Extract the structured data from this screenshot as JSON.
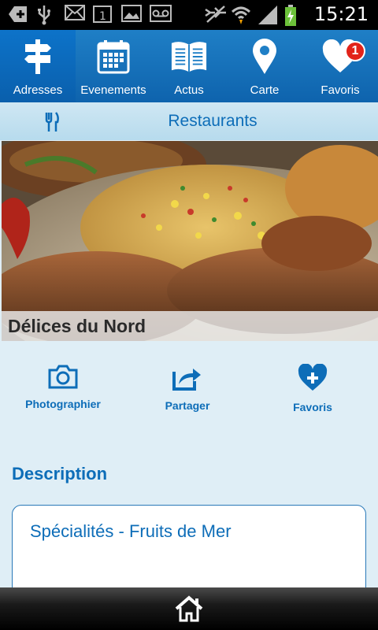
{
  "status_bar": {
    "time": "15:21",
    "icons": [
      "add-icon",
      "usb-icon",
      "mail-icon",
      "calendar-icon",
      "gallery-icon",
      "voicemail-icon",
      "mute-icon",
      "wifi-icon",
      "signal-icon",
      "battery-icon"
    ]
  },
  "nav": {
    "items": [
      {
        "label": "Adresses",
        "icon": "signpost-icon",
        "active": true
      },
      {
        "label": "Evenements",
        "icon": "calendar-icon"
      },
      {
        "label": "Actus",
        "icon": "newspaper-icon"
      },
      {
        "label": "Carte",
        "icon": "map-pin-icon"
      },
      {
        "label": "Favoris",
        "icon": "heart-icon",
        "badge": "1"
      }
    ]
  },
  "category": {
    "icon": "fork-knife-icon",
    "title": "Restaurants"
  },
  "venue": {
    "name": "Délices du Nord"
  },
  "actions": {
    "photograph": "Photographier",
    "share": "Partager",
    "favorite": "Favoris"
  },
  "description": {
    "heading": "Description",
    "text": "Spécialités - Fruits de Mer"
  },
  "colors": {
    "nav_blue": "#1f7fc6",
    "accent_blue": "#0d6db8",
    "badge_red": "#e2231a"
  }
}
